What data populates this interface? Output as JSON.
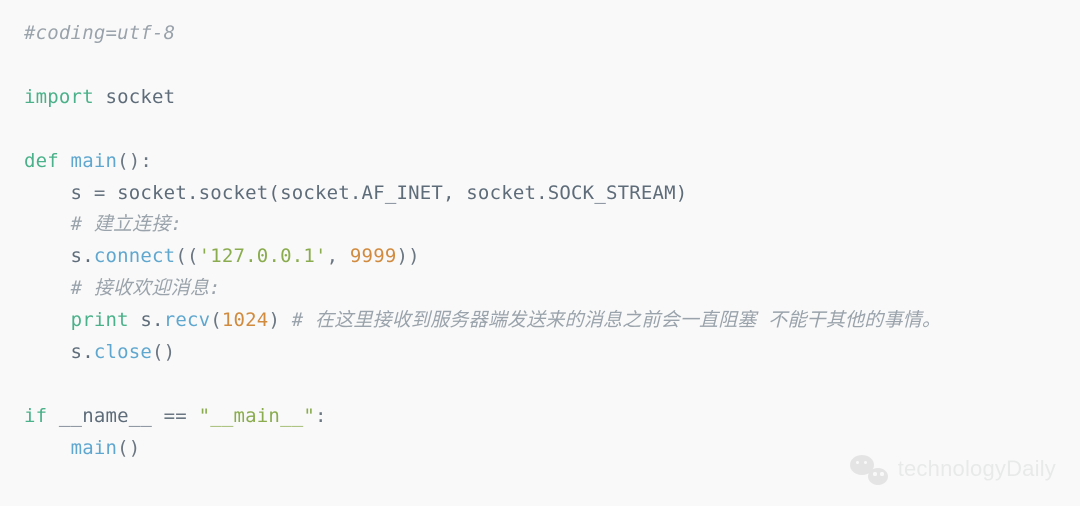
{
  "code": {
    "l1_comment": "#coding=utf-8",
    "l3_kw_import": "import",
    "l3_module": " socket",
    "l5_kw_def": "def",
    "l5_fn": " main",
    "l5_sig": "():",
    "l6_indent": "    s ",
    "l6_eq": "=",
    "l6_call": " socket.socket(socket.AF_INET, socket.SOCK_STREAM)",
    "l7_indent": "    ",
    "l7_comment": "# 建立连接:",
    "l8_indent": "    s.",
    "l8_fn": "connect",
    "l8_open": "((",
    "l8_str": "'127.0.0.1'",
    "l8_comma": ", ",
    "l8_num": "9999",
    "l8_close": "))",
    "l9_indent": "    ",
    "l9_comment": "# 接收欢迎消息:",
    "l10_indent": "    ",
    "l10_print": "print",
    "l10_space": " s.",
    "l10_fn": "recv",
    "l10_open": "(",
    "l10_num": "1024",
    "l10_close": ") ",
    "l10_comment": "# 在这里接收到服务器端发送来的消息之前会一直阻塞 不能干其他的事情。",
    "l11_indent": "    s.",
    "l11_fn": "close",
    "l11_call": "()",
    "l13_kw_if": "if",
    "l13_name": " __name__ ",
    "l13_op": "==",
    "l13_space": " ",
    "l13_str": "\"__main__\"",
    "l13_colon": ":",
    "l14_indent": "    ",
    "l14_fn": "main",
    "l14_call": "()"
  },
  "watermark": {
    "text": "technologyDaily"
  }
}
